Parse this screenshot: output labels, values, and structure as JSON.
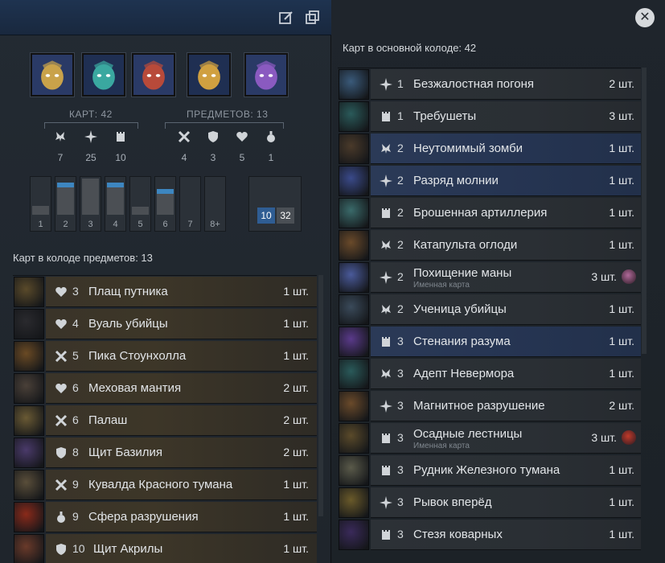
{
  "header": {
    "edit_icon": "edit-icon",
    "copy_icon": "copy-icon",
    "close_icon": "close-icon"
  },
  "heroes": [
    {
      "name_icon": "hero-portrait-1",
      "color": "#2a3a66"
    },
    {
      "name_icon": "hero-portrait-2",
      "color": "#1f2f52"
    },
    {
      "name_icon": "hero-portrait-3",
      "color": "#2a3a66"
    },
    {
      "name_icon": "hero-portrait-4",
      "color": "#1f2f52"
    },
    {
      "name_icon": "hero-portrait-5",
      "color": "#2a3a66"
    }
  ],
  "stats": {
    "cards_label": "КАРТ: 42",
    "items_label": "ПРЕДМЕТОВ: 13",
    "card_types": [
      {
        "icon": "creep-icon",
        "value": "7"
      },
      {
        "icon": "spell-icon",
        "value": "25"
      },
      {
        "icon": "improvement-icon",
        "value": "10"
      }
    ],
    "item_types": [
      {
        "icon": "weapon-icon",
        "value": "4"
      },
      {
        "icon": "armor-icon",
        "value": "3"
      },
      {
        "icon": "health-icon",
        "value": "5"
      },
      {
        "icon": "consumable-icon",
        "value": "1"
      }
    ]
  },
  "mana_curve": {
    "bars": [
      {
        "label": "1",
        "fill": 0.24,
        "blue": false
      },
      {
        "label": "2",
        "fill": 0.88,
        "blue": true
      },
      {
        "label": "3",
        "fill": 0.98,
        "blue": false
      },
      {
        "label": "4",
        "fill": 0.88,
        "blue": true
      },
      {
        "label": "5",
        "fill": 0.22,
        "blue": false
      },
      {
        "label": "6",
        "fill": 0.7,
        "blue": true
      },
      {
        "label": "7",
        "fill": 0.0,
        "blue": false
      },
      {
        "label": "8+",
        "fill": 0.0,
        "blue": false
      }
    ],
    "blue_count": "10",
    "total_count": "32"
  },
  "items_deck": {
    "title": "Карт в колоде предметов: 13",
    "rows": [
      {
        "icon": "health-icon",
        "cost": "3",
        "name": "Плащ путника",
        "count": "1 шт.",
        "art": "#5a4a2a"
      },
      {
        "icon": "health-icon",
        "cost": "4",
        "name": "Вуаль убийцы",
        "count": "1 шт.",
        "art": "#2a2a2e"
      },
      {
        "icon": "weapon-icon",
        "cost": "5",
        "name": "Пика Стоунхолла",
        "count": "1 шт.",
        "art": "#6a4a24"
      },
      {
        "icon": "health-icon",
        "cost": "6",
        "name": "Меховая мантия",
        "count": "2 шт.",
        "art": "#4a4038"
      },
      {
        "icon": "weapon-icon",
        "cost": "6",
        "name": "Палаш",
        "count": "2 шт.",
        "art": "#6a5a34"
      },
      {
        "icon": "armor-icon",
        "cost": "8",
        "name": "Щит Базилия",
        "count": "2 шт.",
        "art": "#4a3a6a"
      },
      {
        "icon": "weapon-icon",
        "cost": "9",
        "name": "Кувалда Красного тумана",
        "count": "1 шт.",
        "art": "#5a4e3a"
      },
      {
        "icon": "consumable-icon",
        "cost": "9",
        "name": "Сфера разрушения",
        "count": "1 шт.",
        "art": "#8a2a1a"
      },
      {
        "icon": "armor-icon",
        "cost": "10",
        "name": "Щит Акрилы",
        "count": "1 шт.",
        "art": "#6a3a2a"
      }
    ]
  },
  "main_deck": {
    "title": "Карт в основной колоде: 42",
    "rows": [
      {
        "icon": "spell-icon",
        "cost": "1",
        "name": "Безжалостная погоня",
        "sub": "",
        "count": "2 шт.",
        "blue": false,
        "art": "#3a5a7a",
        "tag": ""
      },
      {
        "icon": "improvement-icon",
        "cost": "1",
        "name": "Требушеты",
        "sub": "",
        "count": "3 шт.",
        "blue": false,
        "art": "#2a5a5a",
        "tag": ""
      },
      {
        "icon": "creep-icon",
        "cost": "2",
        "name": "Неутомимый зомби",
        "sub": "",
        "count": "1 шт.",
        "blue": true,
        "art": "#4a3a2a",
        "tag": ""
      },
      {
        "icon": "spell-icon",
        "cost": "2",
        "name": "Разряд молнии",
        "sub": "",
        "count": "1 шт.",
        "blue": true,
        "art": "#3a4a8a",
        "tag": ""
      },
      {
        "icon": "improvement-icon",
        "cost": "2",
        "name": "Брошенная артиллерия",
        "sub": "",
        "count": "1 шт.",
        "blue": false,
        "art": "#3a6a6a",
        "tag": ""
      },
      {
        "icon": "creep-icon",
        "cost": "2",
        "name": "Катапульта оглоди",
        "sub": "",
        "count": "1 шт.",
        "blue": false,
        "art": "#6a4a2a",
        "tag": ""
      },
      {
        "icon": "spell-icon",
        "cost": "2",
        "name": "Похищение маны",
        "sub": "Именная карта",
        "count": "3 шт.",
        "blue": false,
        "art": "#4a5a9a",
        "tag": "#b06a9a"
      },
      {
        "icon": "creep-icon",
        "cost": "2",
        "name": "Ученица убийцы",
        "sub": "",
        "count": "1 шт.",
        "blue": false,
        "art": "#3a4a5a",
        "tag": ""
      },
      {
        "icon": "improvement-icon",
        "cost": "3",
        "name": "Стенания разума",
        "sub": "",
        "count": "1 шт.",
        "blue": true,
        "art": "#5a3a8a",
        "tag": ""
      },
      {
        "icon": "creep-icon",
        "cost": "3",
        "name": "Адепт Невермора",
        "sub": "",
        "count": "1 шт.",
        "blue": false,
        "art": "#2a5a5a",
        "tag": ""
      },
      {
        "icon": "spell-icon",
        "cost": "3",
        "name": "Магнитное разрушение",
        "sub": "",
        "count": "2 шт.",
        "blue": false,
        "art": "#6a4a2a",
        "tag": ""
      },
      {
        "icon": "improvement-icon",
        "cost": "3",
        "name": "Осадные лестницы",
        "sub": "Именная карта",
        "count": "3 шт.",
        "blue": false,
        "art": "#5a4a2a",
        "tag": "#c03a2a"
      },
      {
        "icon": "improvement-icon",
        "cost": "3",
        "name": "Рудник Железного тумана",
        "sub": "",
        "count": "1 шт.",
        "blue": false,
        "art": "#5a5a4a",
        "tag": ""
      },
      {
        "icon": "spell-icon",
        "cost": "3",
        "name": "Рывок вперёд",
        "sub": "",
        "count": "1 шт.",
        "blue": false,
        "art": "#6a5a2a",
        "tag": ""
      },
      {
        "icon": "improvement-icon",
        "cost": "3",
        "name": "Стезя коварных",
        "sub": "",
        "count": "1 шт.",
        "blue": false,
        "art": "#3a2a5a",
        "tag": ""
      }
    ]
  }
}
